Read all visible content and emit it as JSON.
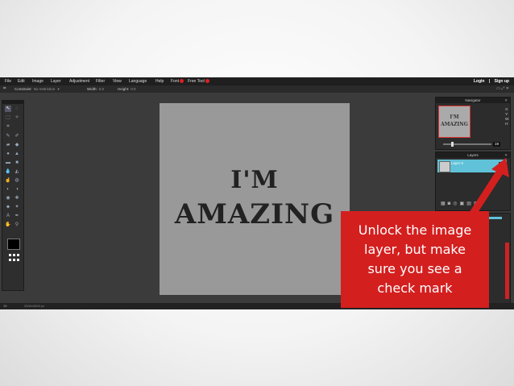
{
  "menubar": {
    "items": [
      "File",
      "Edit",
      "Image",
      "Layer",
      "Adjustment",
      "Filter",
      "View",
      "Language",
      "Help",
      "Font",
      "Free Tool"
    ],
    "badges": {
      "font": "1",
      "free_tool": "1"
    },
    "login": "Login",
    "signup": "Sign up"
  },
  "options": {
    "constraint_label": "Constraint:",
    "constraint_value": "No restriction",
    "width_label": "Width:",
    "width_value": "0.0",
    "height_label": "Height:",
    "height_value": "0.0"
  },
  "canvas": {
    "line1": "I'M",
    "line2": "AMAZING",
    "background_color": "#999999"
  },
  "navigator": {
    "title": "Navigator",
    "thumb_line1": "I'M",
    "thumb_line2": "AMAZING",
    "coords": [
      "X:",
      "Y:",
      "W:",
      "H:"
    ],
    "zoom": "19",
    "zoom_fraction": 0.19
  },
  "layers": {
    "title": "Layers",
    "layer_name": "Layer 0",
    "visible_mark": "✓"
  },
  "status": {
    "zoom": "19",
    "size": "3000x3000 px"
  },
  "callout": {
    "text": "Unlock the image\nlayer, but make\nsure you see a\ncheck mark",
    "color": "#d41f1f"
  }
}
